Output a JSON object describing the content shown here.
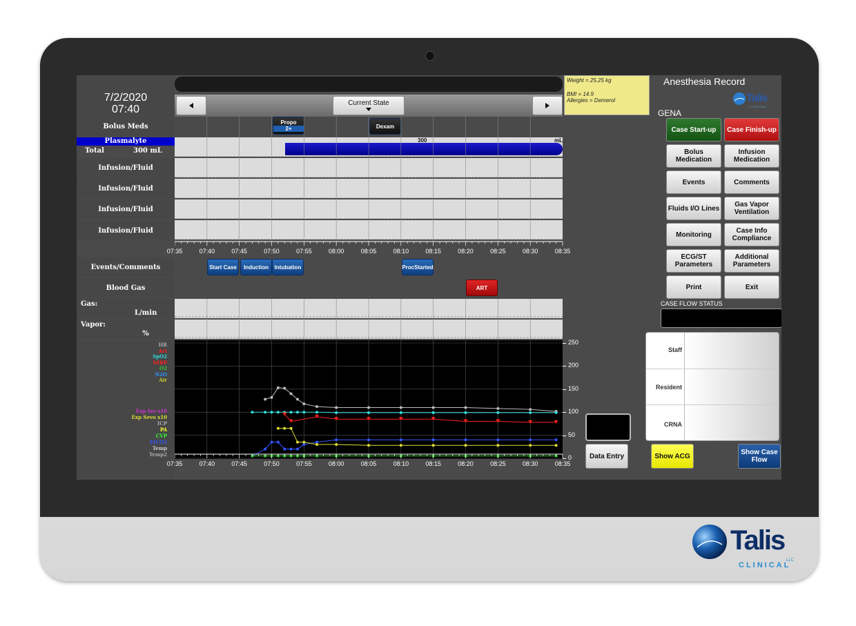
{
  "header": {
    "date": "7/2/2020",
    "time": "07:40",
    "state_label": "Current State",
    "title": "Anesthesia Record",
    "patient_name": "GENA"
  },
  "patient_info": {
    "weight": "Weight = 25.25 kg",
    "bmi": "BMI = 14.9",
    "allergies": "Allergies = Demerol"
  },
  "logo": {
    "name": "Talis",
    "sub": "CLINICAL",
    "suffix": "LLC"
  },
  "rows": {
    "bolus_meds": "Bolus Meds",
    "fluid_name": "Plasmalyte",
    "fluid_total_label": "Total",
    "fluid_total_value": "300 mL",
    "fluid_bar_value": "300",
    "fluid_bar_unit": "mL",
    "infusion_rows": [
      "Infusion/Fluid",
      "Infusion/Fluid",
      "Infusion/Fluid",
      "Infusion/Fluid"
    ],
    "events_comments": "Events/Comments",
    "blood_gas": "Blood Gas",
    "gas": "Gas:",
    "gas_unit": "L/min",
    "vapor": "Vapor:",
    "vapor_unit": "%"
  },
  "bolus_tags": [
    {
      "label": "Propo",
      "sub": "2+"
    },
    {
      "label": "Dexam"
    }
  ],
  "event_tags": [
    "Start Case",
    "Induction",
    "Intubation",
    "ProcStarted"
  ],
  "blood_gas_tag": "ART",
  "time_axis": [
    "07:35",
    "07:40",
    "07:45",
    "07:50",
    "07:55",
    "08:00",
    "08:05",
    "08:10",
    "08:15",
    "08:20",
    "08:25",
    "08:30",
    "08:35"
  ],
  "vitals_legend": [
    {
      "label": "HR",
      "color": "#aaaaaa"
    },
    {
      "label": "Art",
      "color": "#ff2020"
    },
    {
      "label": "SpO2",
      "color": "#33dddd"
    },
    {
      "label": "NIBP",
      "color": "#ff2020"
    },
    {
      "label": "O2",
      "color": "#33cc33"
    },
    {
      "label": "N2O",
      "color": "#3399ff"
    },
    {
      "label": "Air",
      "color": "#cccc33"
    }
  ],
  "vitals_legend2": [
    {
      "label": "Exp Iso x10",
      "color": "#cc33cc"
    },
    {
      "label": "Exp Sevo x10",
      "color": "#dddd33"
    },
    {
      "label": "ICP",
      "color": "#aaaaaa"
    },
    {
      "label": "PA",
      "color": "#ffff33"
    },
    {
      "label": "CVP",
      "color": "#33ff33"
    },
    {
      "label": "EtCO2",
      "color": "#3355ff"
    },
    {
      "label": "Temp",
      "color": "#cccccc"
    },
    {
      "label": "Temp2",
      "color": "#aaaaaa"
    }
  ],
  "y_axis": [
    "250",
    "200",
    "150",
    "100",
    "50",
    "0"
  ],
  "chart_data": {
    "type": "line",
    "x": [
      "07:47",
      "07:49",
      "07:50",
      "07:51",
      "07:52",
      "07:53",
      "07:54",
      "07:55",
      "07:57",
      "08:00",
      "08:05",
      "08:10",
      "08:15",
      "08:20",
      "08:25",
      "08:30",
      "08:34"
    ],
    "series": [
      {
        "name": "HR",
        "values": [
          null,
          128,
          132,
          153,
          152,
          140,
          128,
          118,
          112,
          110,
          110,
          110,
          110,
          110,
          108,
          106,
          102
        ]
      },
      {
        "name": "SpO2",
        "values": [
          100,
          100,
          100,
          100,
          100,
          100,
          100,
          100,
          100,
          99,
          99,
          99,
          99,
          99,
          99,
          99,
          99
        ]
      },
      {
        "name": "NIBP",
        "values": [
          null,
          null,
          null,
          null,
          95,
          80,
          null,
          null,
          90,
          85,
          85,
          85,
          85,
          80,
          80,
          78,
          78
        ]
      },
      {
        "name": "EtCO2",
        "values": [
          5,
          20,
          35,
          35,
          20,
          20,
          20,
          30,
          35,
          40,
          40,
          40,
          40,
          40,
          40,
          40,
          40
        ]
      },
      {
        "name": "PA",
        "values": [
          null,
          null,
          null,
          65,
          65,
          65,
          35,
          35,
          30,
          30,
          28,
          28,
          28,
          28,
          28,
          28,
          28
        ]
      },
      {
        "name": "O2",
        "values": [
          5,
          5,
          5,
          5,
          5,
          5,
          5,
          5,
          5,
          5,
          5,
          5,
          5,
          5,
          5,
          5,
          5
        ]
      }
    ],
    "xlabel": "",
    "ylabel": "",
    "ylim": [
      0,
      250
    ]
  },
  "buttons": {
    "case_startup": "Case Start-up",
    "case_finishup": "Case Finish-up",
    "bolus_medication": "Bolus Medication",
    "infusion_medication": "Infusion Medication",
    "events": "Events",
    "comments": "Comments",
    "fluids": "Fluids I/O Lines",
    "gas_vapor": "Gas Vapor Ventilation",
    "monitoring": "Monitoring",
    "case_info": "Case Info Compliance",
    "ecg": "ECG/ST Parameters",
    "additional": "Additional Parameters",
    "print": "Print",
    "exit": "Exit",
    "data_entry": "Data Entry",
    "show_acg": "Show ACG",
    "show_case_flow": "Show Case Flow"
  },
  "case_flow": {
    "title": "CASE FLOW STATUS",
    "staff": "Staff",
    "resident": "Resident",
    "crna": "CRNA"
  }
}
